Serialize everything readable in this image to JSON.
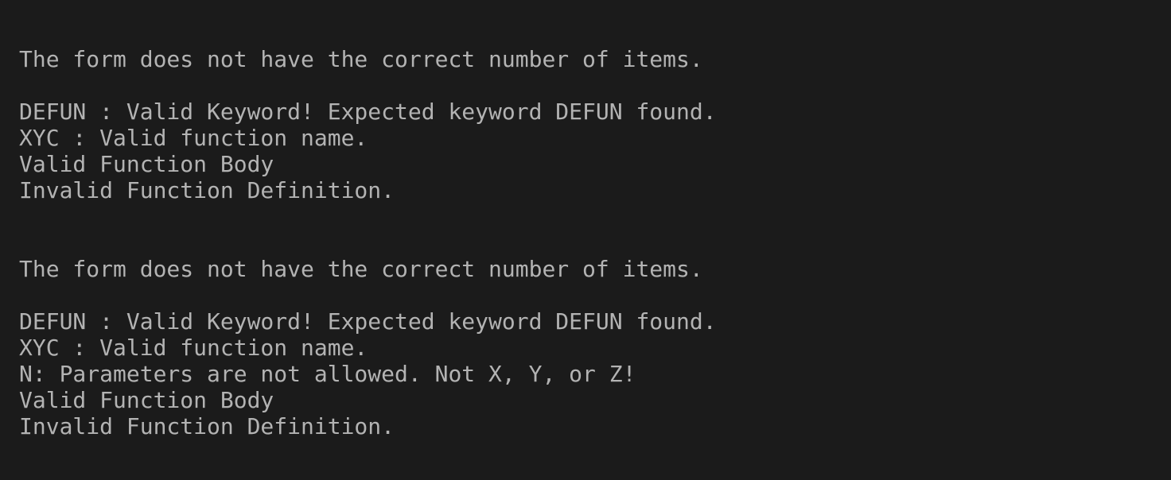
{
  "terminal": {
    "colors": {
      "background": "#1b1b1b",
      "text": "#b3b3b3"
    },
    "blocks": [
      {
        "lines": [
          "The form does not have the correct number of items.",
          "DEFUN : Valid Keyword! Expected keyword DEFUN found.",
          "XYC : Valid function name.",
          "Valid Function Body",
          "Invalid Function Definition."
        ]
      },
      {
        "lines": [
          "The form does not have the correct number of items.",
          "DEFUN : Valid Keyword! Expected keyword DEFUN found.",
          "XYC : Valid function name.",
          "N: Parameters are not allowed. Not X, Y, or Z!",
          "Valid Function Body",
          "Invalid Function Definition."
        ]
      }
    ]
  }
}
